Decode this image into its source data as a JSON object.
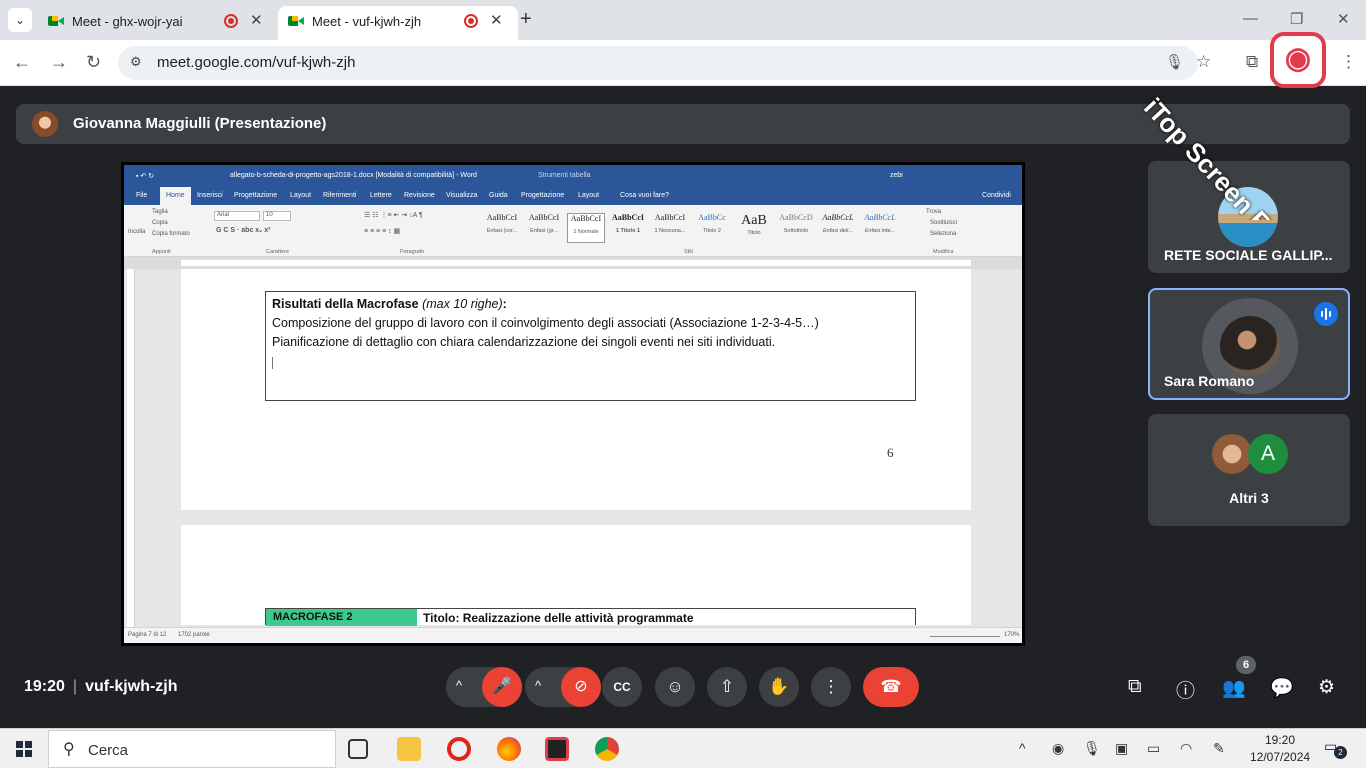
{
  "browser": {
    "tabs": [
      {
        "title": "Meet - ghx-wojr-yai",
        "active": false
      },
      {
        "title": "Meet - vuf-kjwh-zjh",
        "active": true
      }
    ],
    "tab_close_glyph": "✕",
    "new_tab_glyph": "+",
    "menu_glyph": "⌄",
    "url": "meet.google.com/vuf-kjwh-zjh",
    "window_controls": {
      "minimize": "—",
      "restore": "❐",
      "close": "✕"
    },
    "nav": {
      "back": "←",
      "forward": "→",
      "reload": "↻",
      "site_info": "⚙"
    },
    "toolbar_icons": {
      "mic": "🎙",
      "star": "☆",
      "extensions": "⧉",
      "menu": "⋮"
    }
  },
  "meet": {
    "presenter_label": "Giovanna Maggiulli (Presentazione)",
    "meeting_time": "19:20",
    "meeting_code": "vuf-kjwh-zjh",
    "participant_count": "6",
    "tiles": [
      {
        "name": "RETE SOCIALE GALLIP...",
        "speaking": false
      },
      {
        "name": "Sara Romano",
        "speaking": true
      },
      {
        "name": "Altri 3",
        "avatar_letter": "A"
      }
    ],
    "controls": {
      "chevron": "^",
      "mic": "🎤",
      "camera": "⊘",
      "captions": "CC",
      "emoji": "☺",
      "present": "⇧",
      "raise_hand": "✋",
      "more": "⋮",
      "end_call": "☎",
      "right": {
        "cast": "⧉",
        "info": "ⓘ",
        "people": "👥",
        "chat": "💬",
        "activities": "⚙"
      }
    },
    "colors": {
      "end_call": "#ea4335",
      "speaking": "#1a73e8",
      "tile_border": "#8ab4f8"
    }
  },
  "word": {
    "title": "allegato-b-scheda-di-progetto-ags2018-1.docx [Modalità di compatibilità] - Word",
    "tools_label": "Strumenti tabella",
    "user": "zebi",
    "tabs": [
      "File",
      "Home",
      "Inserisci",
      "Progettazione",
      "Layout",
      "Riferimenti",
      "Lettere",
      "Revisione",
      "Visualizza",
      "Guida",
      "Progettazione",
      "Layout"
    ],
    "search_hint": "Cosa vuoi fare?",
    "share": "Condividi",
    "clipboard": {
      "paste": "Incolla",
      "cut": "Taglia",
      "copy": "Copia",
      "format_painter": "Copia formato"
    },
    "font_name": "Arial",
    "font_size": "10",
    "group_labels": {
      "clipboard": "Appunti",
      "font": "Carattere",
      "paragraph": "Paragrafo",
      "styles": "Stili",
      "editing": "Modifica"
    },
    "styles": [
      {
        "preview": "AaBbCcI",
        "name": "Enfasi (cor..."
      },
      {
        "preview": "AaBbCcI",
        "name": "Enfasi (gr..."
      },
      {
        "preview": "AaBbCcI",
        "name": "1 Normale"
      },
      {
        "preview": "AaBbCcI",
        "name": "1 Titolo 1"
      },
      {
        "preview": "AaBbCcI",
        "name": "1 Nessuna..."
      },
      {
        "preview": "AaBbCc",
        "name": "Titolo 2"
      },
      {
        "preview": "AaB",
        "name": "Titolo"
      },
      {
        "preview": "AaBbCcD",
        "name": "Sottotitolo"
      },
      {
        "preview": "AaBbCcL",
        "name": "Enfasi deli..."
      },
      {
        "preview": "AaBbCcL",
        "name": "Enfasi inte..."
      }
    ],
    "editing": {
      "find": "Trova",
      "replace": "Sostituisci",
      "select": "Seleziona"
    },
    "doc": {
      "heading_bold": "Risultati della Macrofase",
      "heading_italic": "(max 10 righe)",
      "heading_tail": ":",
      "line1": "Composizione del gruppo di lavoro con il coinvolgimento degli associati (Associazione 1-2-3-4-5…)",
      "line2": "Pianificazione di dettaglio con chiara calendarizzazione dei singoli eventi nei siti individuati.",
      "page_number": "6",
      "macrofase_label": "MACROFASE 2",
      "macrofase_title": "Titolo: Realizzazione delle attività programmate"
    },
    "status": {
      "page": "Pagina 7 di 12",
      "words": "1702 parole",
      "zoom": "170%"
    },
    "accent": "#2b579a"
  },
  "watermark": "iTop Screen Recorder",
  "taskbar": {
    "search_placeholder": "Cerca",
    "search_glyph": "⚲",
    "time": "19:20",
    "date": "12/07/2024",
    "notifications": "2",
    "tray": {
      "chevron": "^",
      "cam": "◉",
      "mic": "🎙",
      "screen": "▣",
      "battery": "▭",
      "wifi": "◠",
      "pen": "✎"
    }
  }
}
